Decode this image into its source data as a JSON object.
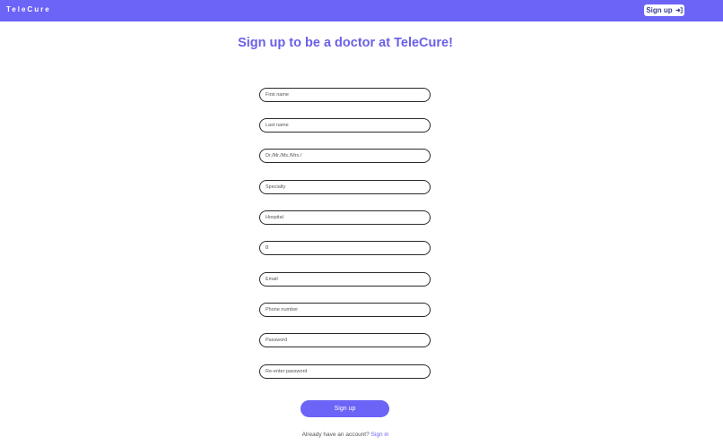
{
  "navbar": {
    "brand": "TeleCure",
    "signup_label": "Sign up",
    "signup_icon": "sign-in-arrow-icon"
  },
  "title": "Sign up to be a doctor at TeleCure!",
  "form": {
    "first_name": {
      "placeholder": "First name",
      "value": ""
    },
    "last_name": {
      "placeholder": "Last name",
      "value": ""
    },
    "title_prefix": {
      "placeholder": "Dr./Mr./Ms./Mrs./",
      "value": ""
    },
    "specialty": {
      "placeholder": "Specialty",
      "value": ""
    },
    "hospital": {
      "placeholder": "Hospital",
      "value": ""
    },
    "number_field": {
      "placeholder": "",
      "value": "0"
    },
    "email": {
      "placeholder": "Email",
      "value": ""
    },
    "phone": {
      "placeholder": "Phone number",
      "value": ""
    },
    "password": {
      "placeholder": "Password",
      "value": ""
    },
    "confirm_password": {
      "placeholder": "Re-enter password",
      "value": ""
    },
    "submit_label": "Sign up"
  },
  "footer": {
    "question": "Already have an account?",
    "signin_label": "Sign in"
  },
  "colors": {
    "accent": "#6c63f7",
    "title": "#6a60e8",
    "border": "#2a2a2a"
  }
}
